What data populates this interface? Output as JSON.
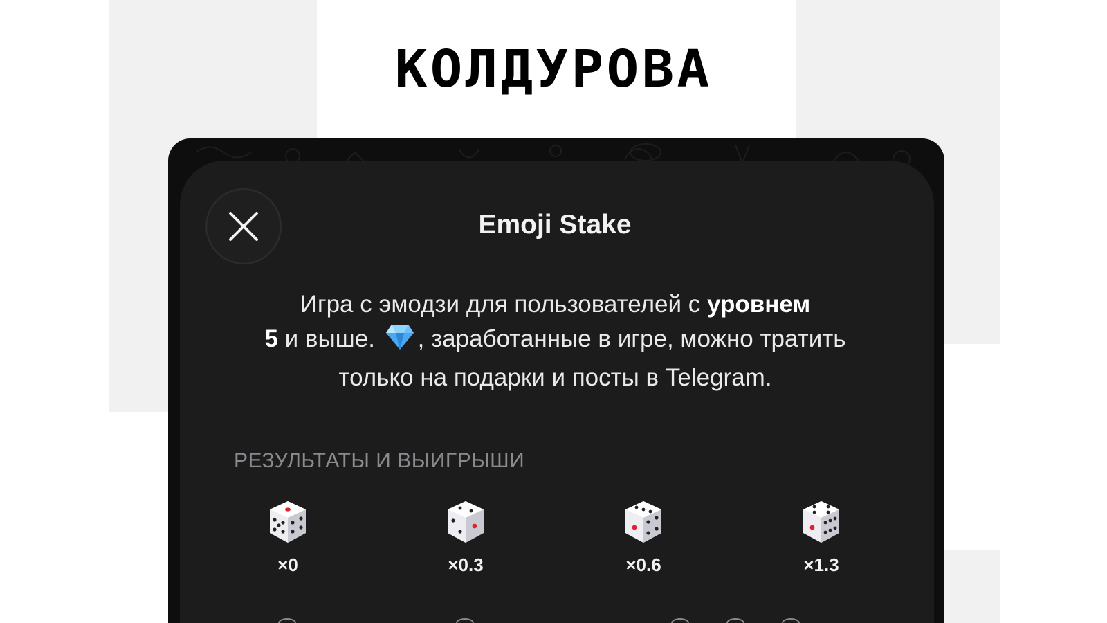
{
  "brand": {
    "logo_text": "КОЛДУРОВА"
  },
  "sheet": {
    "title": "Emoji Stake",
    "close_icon": "close-icon",
    "description": {
      "part1": "Игра с эмодзи для пользователей с ",
      "bold1": "уровнем",
      "bold2": "5",
      "part2": " и выше. ",
      "gem_icon": "gem-icon",
      "part3": ", заработанные в игре, можно тратить только на подарки и посты в Telegram."
    },
    "section_header": "РЕЗУЛЬТАТЫ И ВЫИГРЫШИ",
    "outcomes": [
      {
        "icon": "dice-icon",
        "face": 5,
        "multiplier": "×0"
      },
      {
        "icon": "dice-icon",
        "face": 2,
        "multiplier": "×0.3"
      },
      {
        "icon": "dice-icon",
        "face": 3,
        "multiplier": "×0.6"
      },
      {
        "icon": "dice-icon",
        "face": 4,
        "multiplier": "×1.3"
      }
    ]
  },
  "colors": {
    "page_bg": "#ffffff",
    "side_block": "#f1f1f1",
    "phone_bg": "#0e0e0f",
    "sheet_bg": "#1c1c1d",
    "text_primary": "#f2f2f2",
    "text_secondary": "#8b8b8f",
    "pip_red": "#e0222c",
    "gem_blue": "#5ab8ff"
  }
}
